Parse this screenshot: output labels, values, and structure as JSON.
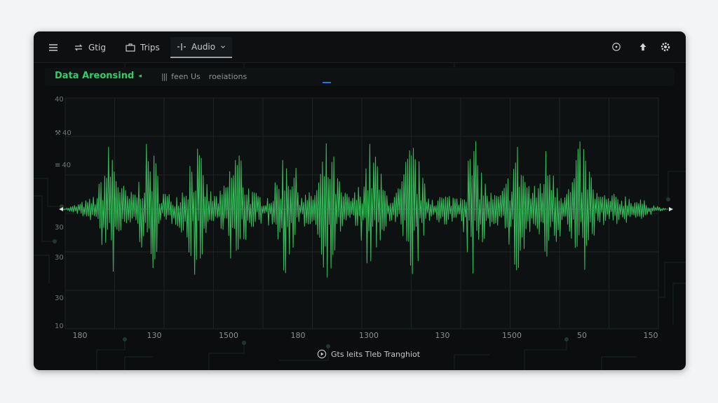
{
  "toolbar": {
    "item1_label": "Gtig",
    "item2_label": "Trips",
    "item3_label": "Audio"
  },
  "panel": {
    "title": "Data Areonsind",
    "sub_prefix": "feen Us",
    "sub_label": "roeiations"
  },
  "plot": {
    "y_ticks": [
      "40",
      "40",
      "40",
      "30",
      "30",
      "30",
      "10"
    ],
    "x_ticks": [
      "180",
      "130",
      "1500",
      "180",
      "1300",
      "130",
      "1500",
      "50",
      "150"
    ]
  },
  "status": {
    "text": "Gts Ieits Tleb Tranghiot"
  },
  "colors": {
    "accent": "#2fcf6a",
    "wave": "#39c760",
    "background": "#0b0d0e"
  },
  "icons": [
    "menu-icon",
    "loop-icon",
    "briefcase-icon",
    "waveform-icon",
    "chevron-down-icon",
    "compass-icon",
    "arrow-up-icon",
    "gear-icon",
    "play-circle-icon"
  ]
}
